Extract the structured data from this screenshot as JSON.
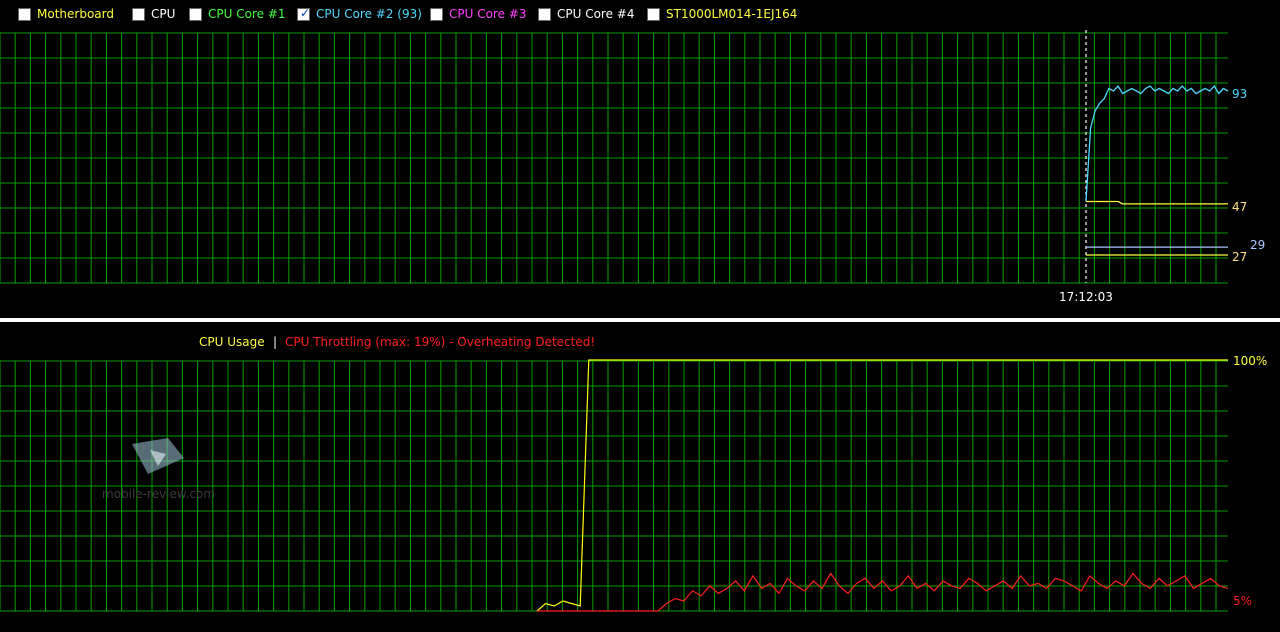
{
  "legend": [
    {
      "label": "Motherboard",
      "checked": true,
      "color": "#ffff40"
    },
    {
      "label": "CPU",
      "checked": true,
      "color": "#ffffff"
    },
    {
      "label": "CPU Core #1",
      "checked": false,
      "color": "#40ff40"
    },
    {
      "label": "CPU Core #2 (93)",
      "checked": true,
      "color": "#4fd8ff"
    },
    {
      "label": "CPU Core #3",
      "checked": false,
      "color": "#ff40ff"
    },
    {
      "label": "CPU Core #4",
      "checked": false,
      "color": "#ffffff"
    },
    {
      "label": "ST1000LM014-1EJ164",
      "checked": true,
      "color": "#ffff40"
    }
  ],
  "usage_header": {
    "cpu_usage": "CPU Usage",
    "separator": "|",
    "throttling": "CPU Throttling (max: 19%) - Overheating Detected!"
  },
  "colors": {
    "grid": "#00a000",
    "usage": "#ffff00",
    "throttle": "#ff2020",
    "cpu_line": "#4fd8ff"
  },
  "watermark": "mobile-review.com",
  "chart_data": [
    {
      "type": "line",
      "title": "",
      "x_marker_label": "17:12:03",
      "series": [
        {
          "name": "CPU Core #2 (93)",
          "end_label": "93",
          "values": [
            48,
            78,
            85,
            88,
            90,
            94,
            93,
            95,
            92,
            93,
            94,
            93,
            92,
            94,
            95,
            93,
            94,
            93,
            92,
            94,
            93,
            95,
            93,
            94,
            92,
            93,
            94,
            93,
            95,
            92,
            94,
            93
          ]
        },
        {
          "name": "Motherboard",
          "end_label": "47",
          "values": [
            48,
            48,
            48,
            48,
            48,
            48,
            48,
            48,
            47,
            47,
            47,
            47,
            47,
            47,
            47,
            47,
            47,
            47,
            47,
            47,
            47,
            47,
            47,
            47,
            47,
            47,
            47,
            47,
            47,
            47,
            47,
            47
          ]
        },
        {
          "name": "CPU",
          "end_label": "29",
          "values": [
            29,
            29,
            29,
            29,
            29,
            29,
            29,
            29,
            29,
            29,
            29,
            29,
            29,
            29,
            29,
            29,
            29,
            29,
            29,
            29,
            29,
            29,
            29,
            29,
            29,
            29,
            29,
            29,
            29,
            29,
            29,
            29
          ]
        },
        {
          "name": "ST1000LM014-1EJ164",
          "end_label": "27",
          "values": [
            27,
            27,
            27,
            27,
            27,
            27,
            27,
            27,
            27,
            27,
            27,
            27,
            27,
            27,
            27,
            27,
            27,
            27,
            27,
            27,
            27,
            27,
            27,
            27,
            27,
            27,
            27,
            27,
            27,
            27,
            27,
            27
          ]
        }
      ]
    },
    {
      "type": "line",
      "title": "",
      "y_max_label": "100%",
      "y_min_label": "5%",
      "series": [
        {
          "name": "CPU Usage",
          "values": [
            0,
            3,
            2,
            4,
            3,
            2,
            100,
            100,
            100,
            100,
            100,
            100,
            100,
            100,
            100,
            100,
            100,
            100,
            100,
            100,
            100,
            100,
            100,
            100,
            100,
            100,
            100,
            100,
            100,
            100,
            100,
            100,
            100,
            100,
            100,
            100,
            100,
            100,
            100,
            100,
            100,
            100,
            100,
            100,
            100,
            100,
            100,
            100,
            100,
            100,
            100,
            100,
            100,
            100,
            100,
            100,
            100,
            100,
            100,
            100,
            100,
            100,
            100,
            100,
            100,
            100,
            100,
            100,
            100,
            100,
            100,
            100,
            100,
            100,
            100,
            100,
            100,
            100,
            100,
            100,
            100
          ]
        },
        {
          "name": "CPU Throttling",
          "values": [
            0,
            0,
            0,
            0,
            0,
            0,
            0,
            0,
            0,
            0,
            0,
            0,
            0,
            0,
            0,
            3,
            5,
            4,
            8,
            6,
            10,
            7,
            9,
            12,
            8,
            14,
            9,
            11,
            7,
            13,
            10,
            8,
            12,
            9,
            15,
            10,
            7,
            11,
            13,
            9,
            12,
            8,
            10,
            14,
            9,
            11,
            8,
            12,
            10,
            9,
            13,
            11,
            8,
            10,
            12,
            9,
            14,
            10,
            11,
            9,
            13,
            12,
            10,
            8,
            14,
            11,
            9,
            12,
            10,
            15,
            11,
            9,
            13,
            10,
            12,
            14,
            9,
            11,
            13,
            10,
            9
          ]
        }
      ]
    }
  ]
}
